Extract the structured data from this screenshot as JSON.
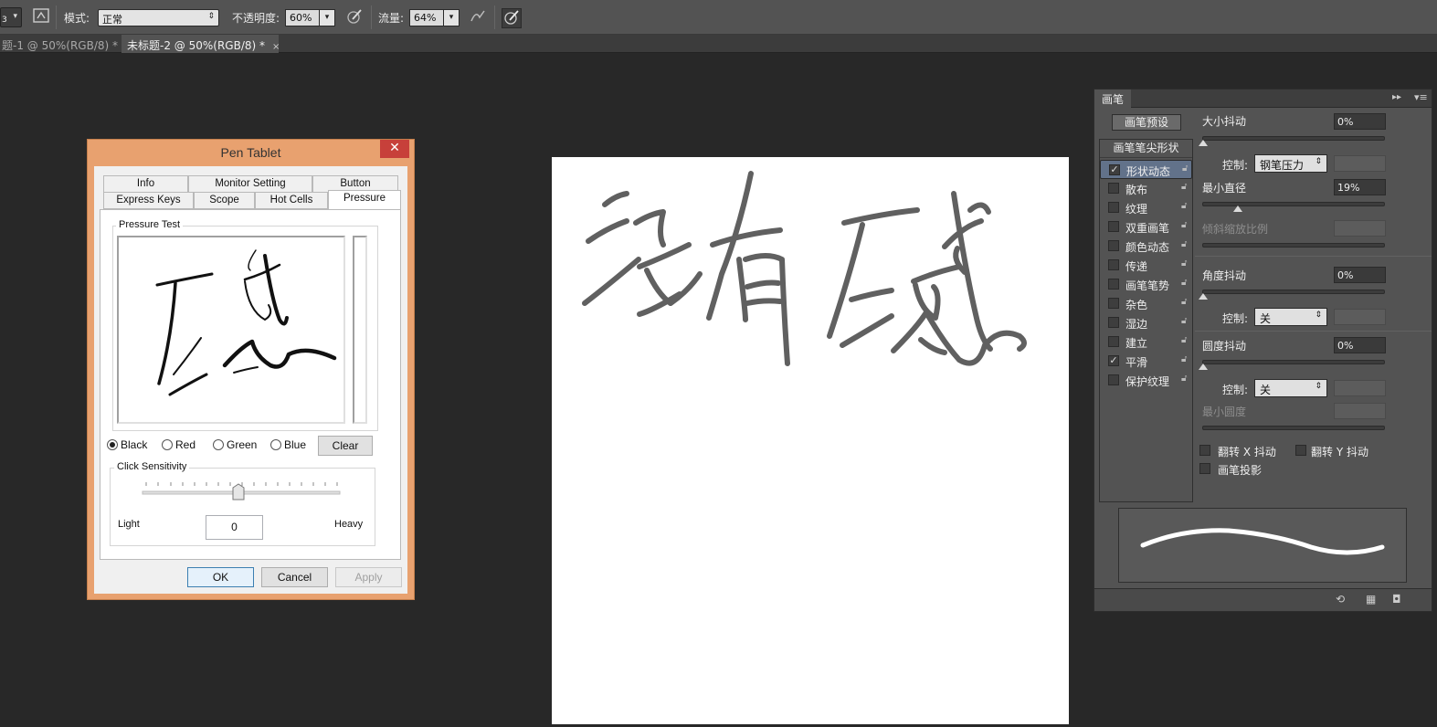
{
  "optbar": {
    "brush_size": "3",
    "mode_label": "模式:",
    "mode_value": "正常",
    "opacity_label": "不透明度:",
    "opacity_value": "60%",
    "flow_label": "流量:",
    "flow_value": "64%"
  },
  "tabs": [
    {
      "label": "题-1 @ 50%(RGB/8) *",
      "close": "×"
    },
    {
      "label": "未标题-2 @ 50%(RGB/8) *",
      "close": "×"
    }
  ],
  "canvas": {
    "written_text": "没有压感"
  },
  "dialog": {
    "title": "Pen Tablet",
    "close": "✕",
    "tabs_row1": [
      "Info",
      "Monitor Setting",
      "Button"
    ],
    "tabs_row2": [
      "Express Keys",
      "Scope",
      "Hot Cells",
      "Pressure"
    ],
    "pressure_test_label": "Pressure Test",
    "drawn_text": "压感",
    "colors": [
      {
        "label": "Black",
        "selected": true
      },
      {
        "label": "Red",
        "selected": false
      },
      {
        "label": "Green",
        "selected": false
      },
      {
        "label": "Blue",
        "selected": false
      }
    ],
    "clear_label": "Clear",
    "click_sensitivity_label": "Click Sensitivity",
    "sensitivity_value": "0",
    "light_label": "Light",
    "heavy_label": "Heavy",
    "ok_label": "OK",
    "cancel_label": "Cancel",
    "apply_label": "Apply"
  },
  "brush_panel": {
    "tab": "画笔",
    "presets_button": "画笔预设",
    "tip_shape": "画笔笔尖形状",
    "categories": [
      {
        "label": "形状动态",
        "checked": true,
        "selected": true
      },
      {
        "label": "散布",
        "checked": false
      },
      {
        "label": "纹理",
        "checked": false
      },
      {
        "label": "双重画笔",
        "checked": false
      },
      {
        "label": "颜色动态",
        "checked": false
      },
      {
        "label": "传递",
        "checked": false
      },
      {
        "label": "画笔笔势",
        "checked": false
      },
      {
        "label": "杂色",
        "checked": false
      },
      {
        "label": "湿边",
        "checked": false
      },
      {
        "label": "建立",
        "checked": false
      },
      {
        "label": "平滑",
        "checked": true
      },
      {
        "label": "保护纹理",
        "checked": false
      }
    ],
    "size_jitter_label": "大小抖动",
    "size_jitter_value": "0%",
    "control_label": "控制:",
    "control1_value": "钢笔压力",
    "min_diameter_label": "最小直径",
    "min_diameter_value": "19%",
    "tilt_scale_label": "倾斜缩放比例",
    "angle_jitter_label": "角度抖动",
    "angle_jitter_value": "0%",
    "control2_value": "关",
    "roundness_jitter_label": "圆度抖动",
    "roundness_jitter_value": "0%",
    "control3_value": "关",
    "min_roundness_label": "最小圆度",
    "flip_x_label": "翻转 X 抖动",
    "flip_y_label": "翻转 Y 抖动",
    "brush_projection_label": "画笔投影"
  }
}
